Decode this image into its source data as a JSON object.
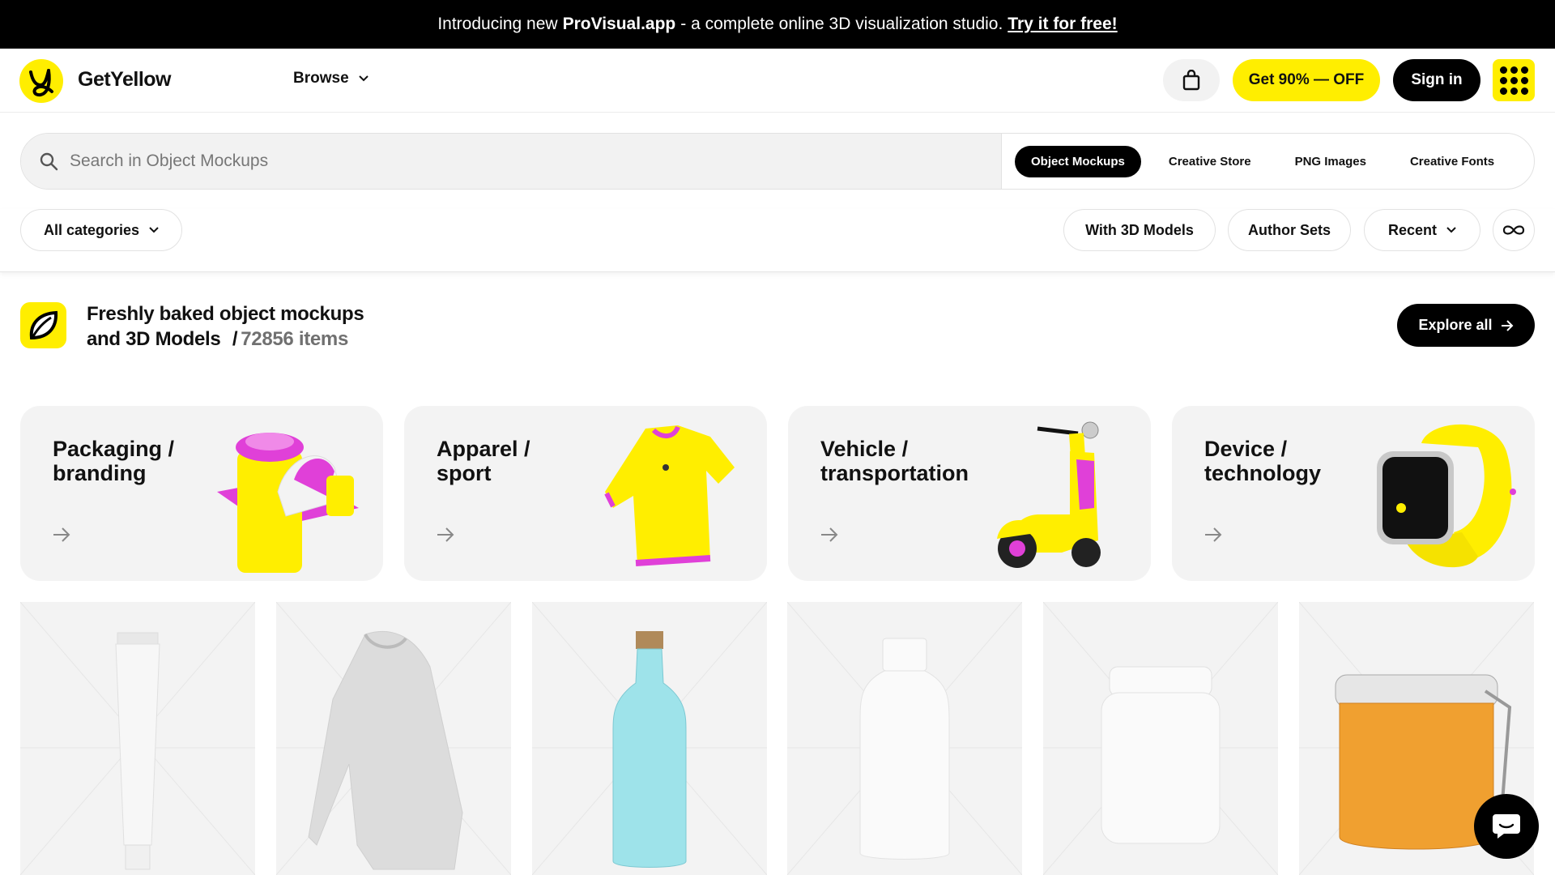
{
  "promo": {
    "prefix": "Introducing new",
    "app": "ProVisual.app",
    "middle": "- a complete online 3D visualization studio.",
    "link": "Try it for free!"
  },
  "header": {
    "brand": "GetYellow",
    "browse": "Browse",
    "offer": "Get 90% — OFF",
    "signin": "Sign in"
  },
  "search": {
    "placeholder": "Search in Object Mockups",
    "tabs": [
      "Object Mockups",
      "Creative Store",
      "PNG Images",
      "Creative Fonts"
    ],
    "active_tab": "Object Mockups"
  },
  "filters": {
    "categories": "All categories",
    "with3d": "With 3D Models",
    "author_sets": "Author Sets",
    "sort": "Recent"
  },
  "section": {
    "line1": "Freshly baked object mockups",
    "line2": "and 3D Models",
    "separator": "/",
    "count": "72856 items",
    "explore": "Explore all"
  },
  "categories": [
    {
      "line1": "Packaging /",
      "line2": "branding"
    },
    {
      "line1": "Apparel /",
      "line2": "sport"
    },
    {
      "line1": "Vehicle /",
      "line2": "transportation"
    },
    {
      "line1": "Device /",
      "line2": "technology"
    }
  ],
  "colors": {
    "brand_yellow": "#ffee00",
    "accent_magenta": "#e040d8",
    "black": "#000000",
    "card_bg": "#f3f3f3"
  }
}
